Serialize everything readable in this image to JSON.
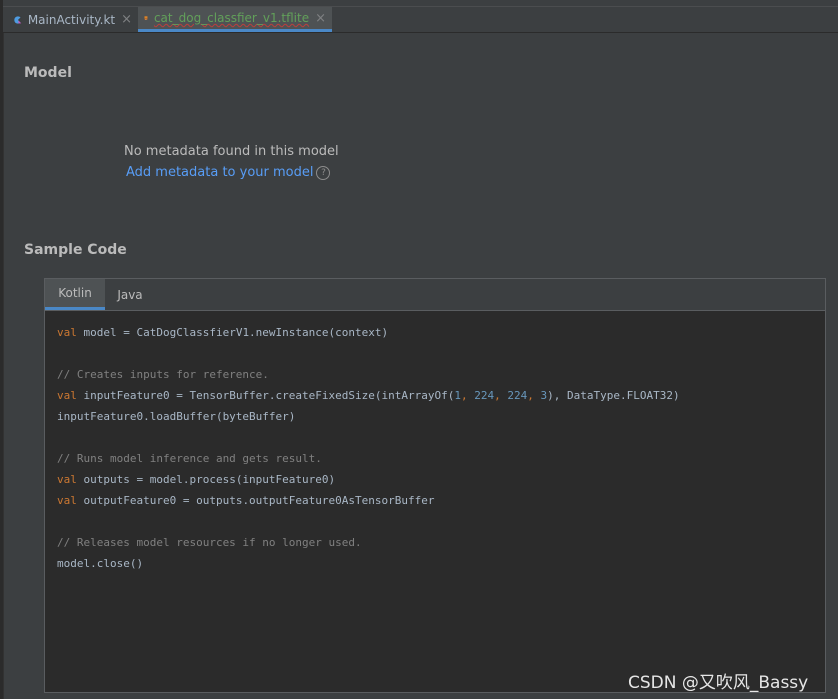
{
  "tabs": [
    {
      "label": "MainActivity.kt",
      "icon": "kotlin-file-icon"
    },
    {
      "label": "cat_dog_classfier_v1.tflite",
      "icon": "tflite-file-icon"
    }
  ],
  "model_section": {
    "title": "Model",
    "no_metadata": "No metadata found in this model",
    "add_metadata_link": "Add metadata to your model",
    "help_glyph": "?"
  },
  "sample_code": {
    "title": "Sample Code",
    "tabs": [
      "Kotlin",
      "Java"
    ],
    "selected_tab": "Kotlin",
    "lines": {
      "l1_kw": "val",
      "l1_rest": " model = CatDogClassfierV1.newInstance(context)",
      "l2": "// Creates inputs for reference.",
      "l3_kw": "val",
      "l3_a": " inputFeature0 = TensorBuffer.createFixedSize(intArrayOf(",
      "l3_n1": "1",
      "l3_c1": ", ",
      "l3_n2": "224",
      "l3_c2": ", ",
      "l3_n3": "224",
      "l3_c3": ", ",
      "l3_n4": "3",
      "l3_b": "), DataType.FLOAT32)",
      "l4": "inputFeature0.loadBuffer(byteBuffer)",
      "l5": "// Runs model inference and gets result.",
      "l6_kw": "val",
      "l6_rest": " outputs = model.process(inputFeature0)",
      "l7_kw": "val",
      "l7_rest": " outputFeature0 = outputs.outputFeature0AsTensorBuffer",
      "l8": "// Releases model resources if no longer used.",
      "l9": "model.close()"
    }
  },
  "watermark": "CSDN @又吹风_Bassy",
  "colors": {
    "background": "#3c3f41",
    "editor": "#2b2b2b",
    "link": "#589df6",
    "keyword": "#cc7832",
    "number": "#6897bb",
    "comment": "#808080",
    "active_tab_underline": "#4a88c7"
  }
}
